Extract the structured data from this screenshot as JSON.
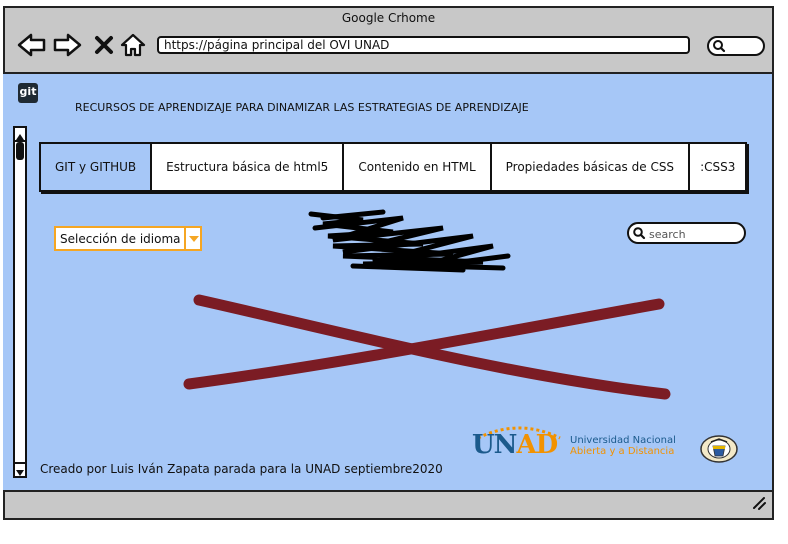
{
  "browser": {
    "title": "Google Crhome",
    "url": "https://página principal del OVI UNAD",
    "nav_icons": [
      "back-arrow-icon",
      "forward-arrow-icon",
      "close-x-icon",
      "home-icon"
    ]
  },
  "page": {
    "logo_text": "git",
    "heading": "RECURSOS DE APRENDIZAJE PARA DINAMIZAR LAS ESTRATEGIAS DE APRENDIZAJE",
    "tabs": [
      {
        "label": "GIT y GITHUB",
        "active": true
      },
      {
        "label": "Estructura básica de html5"
      },
      {
        "label": "Contenido en HTML"
      },
      {
        "label": "Propiedades básicas de CSS"
      },
      {
        "label": ":CSS3"
      }
    ],
    "language_select": {
      "value": "Selección de idioma"
    },
    "search": {
      "placeholder": "search"
    },
    "footer": "Creado por Luis Iván Zapata parada para la UNAD septiembre2020",
    "unad_logo": {
      "letters_un": "UN",
      "letters_ad": "AD",
      "line1": "Universidad Nacional",
      "line2": "Abierta y a Distancia"
    }
  },
  "colors": {
    "page_background": "#a6c7f7",
    "window_chrome": "#c8c8c8",
    "accent_orange": "#f5a623",
    "image_placeholder_cross": "#7b1c24",
    "unad_blue": "#1b5a8c"
  }
}
